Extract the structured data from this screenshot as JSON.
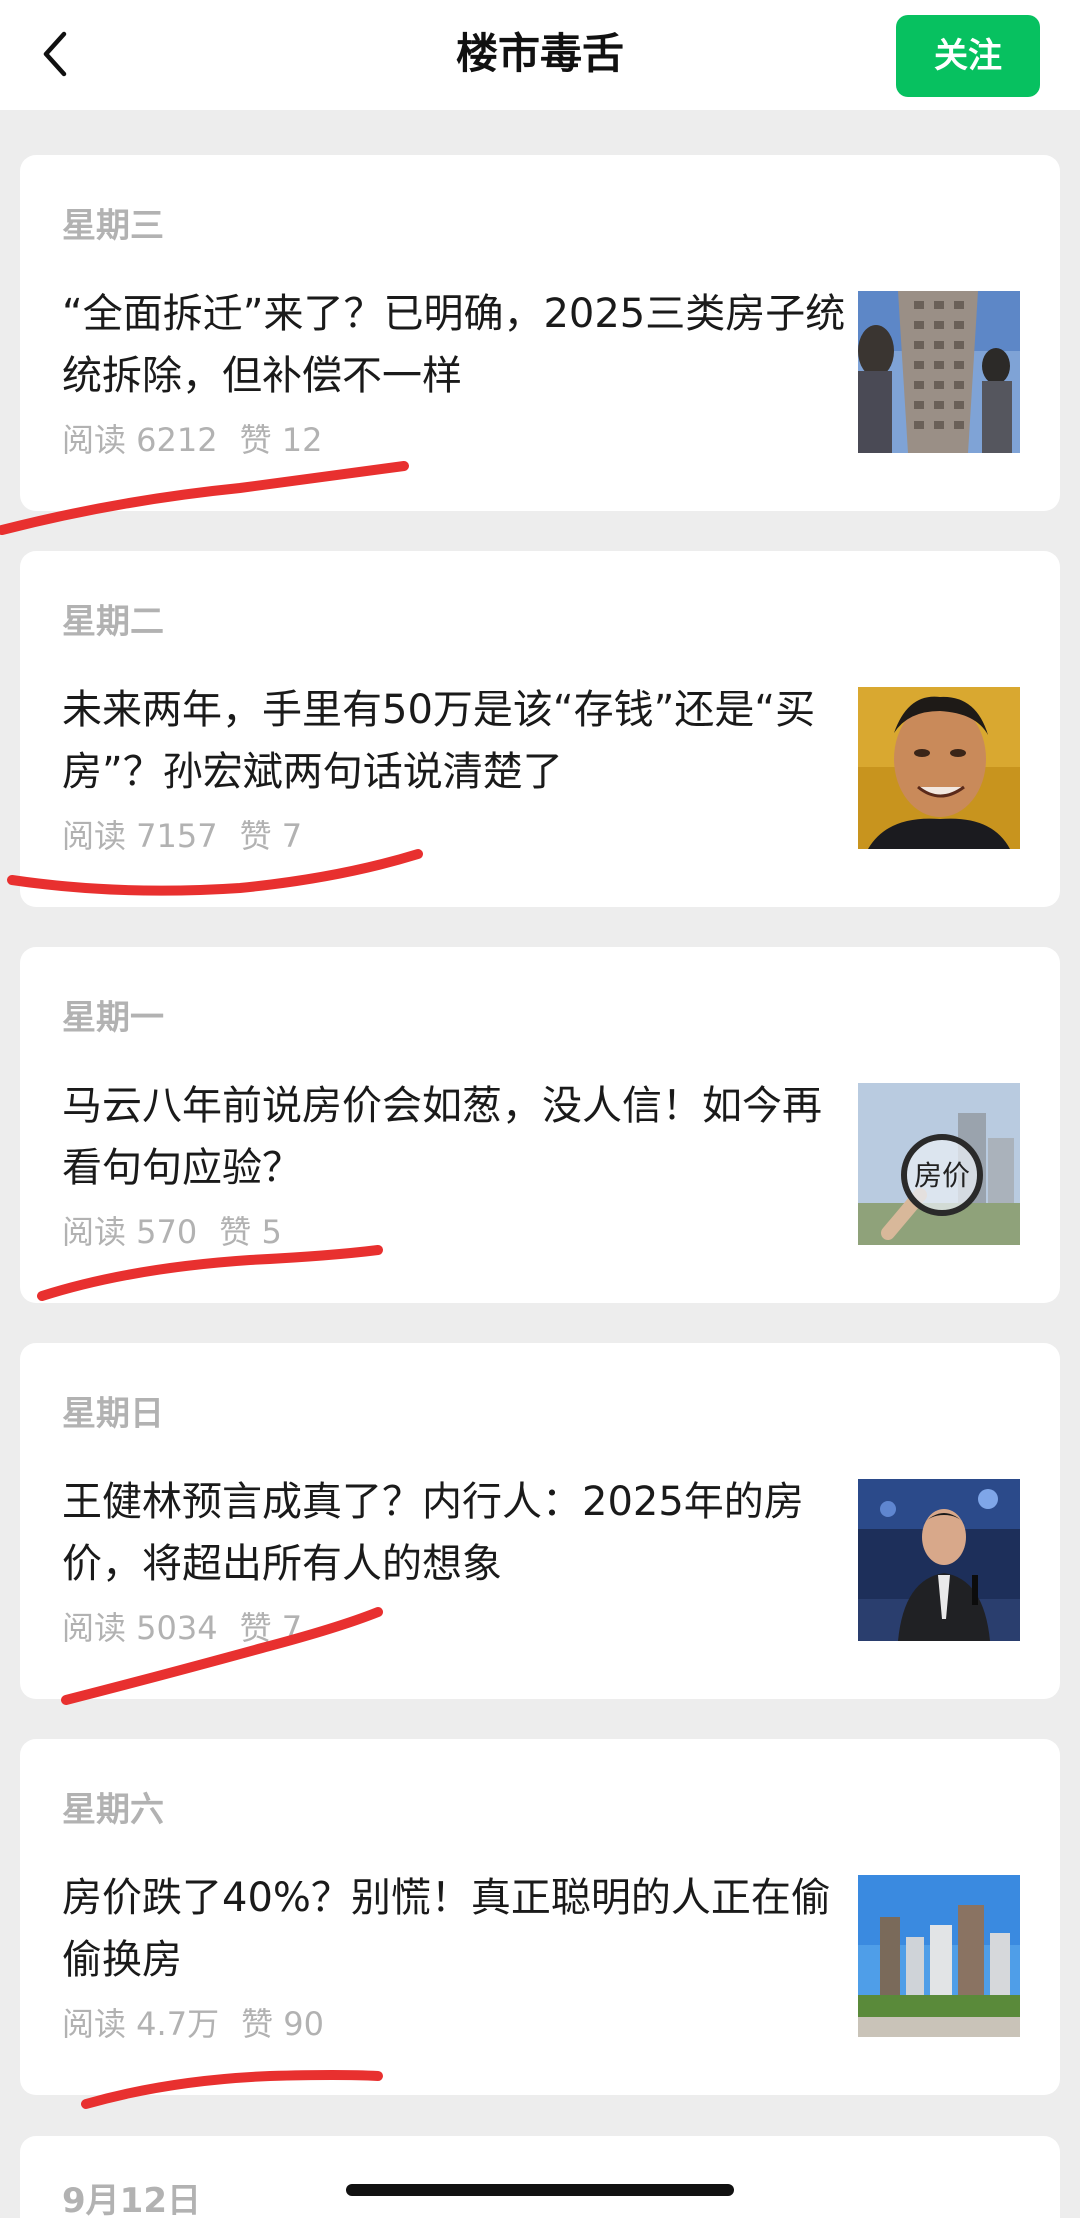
{
  "header": {
    "title": "楼市毒舌",
    "follow_label": "关注",
    "back_icon": "chevron-left-icon"
  },
  "articles": [
    {
      "day": "星期三",
      "title": "“全面拆迁”来了？已明确，2025三类房子统统拆除，但补偿不一样",
      "reads": "阅读 6212",
      "likes": "赞 12",
      "thumb": "high-rise-building-photo"
    },
    {
      "day": "星期二",
      "title": "未来两年，手里有50万是该“存钱”还是“买房”？孙宏斌两句话说清楚了",
      "reads": "阅读 7157",
      "likes": "赞 7",
      "thumb": "smiling-man-portrait-photo"
    },
    {
      "day": "星期一",
      "title": "马云八年前说房价会如葱，没人信！如今再看句句应验？",
      "reads": "阅读 570",
      "likes": "赞 5",
      "thumb": "magnifier-house-price-photo",
      "thumb_text": "房价"
    },
    {
      "day": "星期日",
      "title": "王健林预言成真了？内行人：2025年的房价，将超出所有人的想象",
      "reads": "阅读 5034",
      "likes": "赞 7",
      "thumb": "man-speaking-at-event-photo"
    },
    {
      "day": "星期六",
      "title": "房价跌了40%？别慌！真正聪明的人正在偷偷换房",
      "reads": "阅读 4.7万",
      "likes": "赞 90",
      "thumb": "city-skyline-photo"
    }
  ],
  "next_article": {
    "day": "9月12日"
  },
  "colors": {
    "accent": "#07c160",
    "background": "#ededed",
    "muted_text": "#b2b2b2",
    "marker": "#e8302f"
  }
}
